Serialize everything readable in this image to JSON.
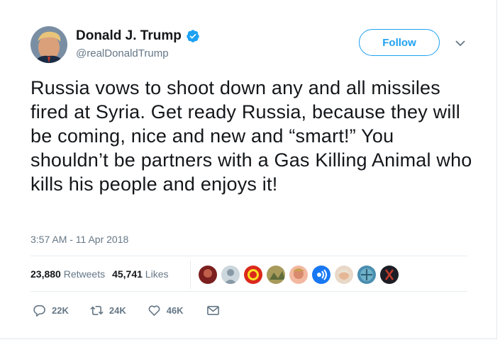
{
  "user": {
    "display_name": "Donald J. Trump",
    "handle": "@realDonaldTrump",
    "verified_icon": "verified-badge-icon",
    "avatar_icon": "profile-photo"
  },
  "follow_button": {
    "label": "Follow"
  },
  "tweet": {
    "text": "Russia vows to shoot down any and all missiles fired at Syria. Get ready Russia, because they will be coming, nice and new and “smart!” You shouldn’t be partners with a Gas Killing Animal who kills his people and enjoys it!",
    "timestamp": "3:57 AM - 11 Apr 2018"
  },
  "stats": {
    "retweets_count": "23,880",
    "retweets_label": "Retweets",
    "likes_count": "45,741",
    "likes_label": "Likes"
  },
  "actions": {
    "reply_count": "22K",
    "retweet_count": "24K",
    "like_count": "46K"
  },
  "colors": {
    "accent": "#1da1f2",
    "muted": "#657786",
    "text": "#14171a"
  }
}
